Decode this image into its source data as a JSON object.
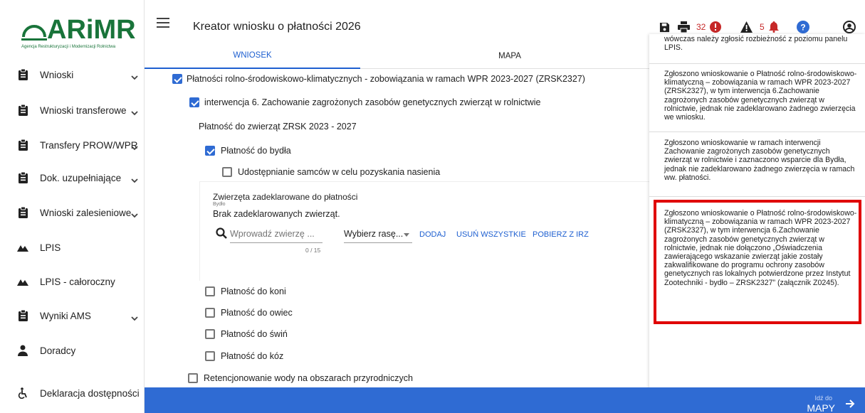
{
  "logo": {
    "text": "ARiMR",
    "subtitle": "Agencja Restrukturyzacji i Modernizacji Rolnictwa"
  },
  "sidebar": {
    "items": [
      {
        "label": "Wnioski",
        "icon": "clipboard-icon",
        "expandable": true
      },
      {
        "label": "Wnioski transferowe",
        "icon": "clipboard-icon",
        "expandable": true
      },
      {
        "label": "Transfery PROW/WPR",
        "icon": "clipboard-icon",
        "expandable": true
      },
      {
        "label": "Dok. uzupełniające",
        "icon": "clipboard-icon",
        "expandable": true
      },
      {
        "label": "Wnioski zalesieniowe",
        "icon": "clipboard-icon",
        "expandable": true
      },
      {
        "label": "LPIS",
        "icon": "terrain-icon",
        "expandable": false
      },
      {
        "label": "LPIS - całoroczny",
        "icon": "terrain-icon",
        "expandable": false
      },
      {
        "label": "Wyniki AMS",
        "icon": "clipboard-icon",
        "expandable": true
      },
      {
        "label": "Doradcy",
        "icon": "person-icon",
        "expandable": false
      },
      {
        "label": "Deklaracja dostępności",
        "icon": "accessibility-icon",
        "expandable": false
      }
    ]
  },
  "header": {
    "title": "Kreator wniosku o płatności 2026",
    "error_count": "32",
    "warning_count": "5"
  },
  "tabs": [
    {
      "label": "WNIOSEK",
      "active": true
    },
    {
      "label": "MAPA",
      "active": false
    }
  ],
  "form": {
    "main_item": "Płatności rolno-środowiskowo-klimatycznych - zobowiązania w ramach WPR 2023-2027 (ZRSK2327)",
    "intervention": "interwencja 6. Zachowanie zagrożonych zasobów genetycznych zwierząt w rolnictwie",
    "section_title": "Płatność do zwierząt ZRSK 2023 - 2027",
    "cattle": "Płatność do bydła",
    "semen": "Udostępnianie samców w celu pozyskania nasienia",
    "panel": {
      "title": "Zwierzęta zadeklarowane do płatności",
      "subtitle": "Bydło",
      "empty": "Brak zadeklarowanych zwierząt.",
      "search_placeholder": "Wprowadź zwierzę ...",
      "counter": "0 / 15",
      "breed_select": "Wybierz rasę...",
      "add": "DODAJ",
      "remove_all": "USUŃ WSZYSTKIE",
      "fetch": "POBIERZ Z IRZ"
    },
    "horses": "Płatność do koni",
    "sheep": "Płatność do owiec",
    "pigs": "Płatność do świń",
    "goats": "Płatność do kóz",
    "retention": "Retencjonowanie wody na obszarach przyrodniczych"
  },
  "messages": [
    {
      "text": "wówczas należy zgłosić rozbieżność z poziomu panelu LPIS."
    },
    {
      "text": "Zgłoszono wnioskowanie o Płatność rolno-środowiskowo-klimatyczną – zobowiązania w ramach WPR 2023-2027 (ZRSK2327), w tym interwencja 6.Zachowanie zagrożonych zasobów genetycznych zwierząt w rolnictwie, jednak nie zadeklarowano żadnego zwierzęcia we wniosku."
    },
    {
      "text": "Zgłoszono wnioskowanie w ramach interwencji Zachowanie zagrożonych zasobów genetycznych zwierząt w rolnictwie i zaznaczono wsparcie dla Bydła, jednak nie zadeklarowano żadnego zwierzęcia w ramach ww. płatności."
    },
    {
      "text": "Zgłoszono wnioskowanie o Płatność rolno-środowiskowo-klimatyczną – zobowiązania w ramach WPR 2023-2027 (ZRSK2327), w tym interwencja 6.Zachowanie zagrożonych zasobów genetycznych zwierząt w rolnictwie, jednak nie dołączono „Oświadczenia zawierającego wskazanie zwierząt jakie zostały zakwalifikowane do programu ochrony zasobów genetycznych ras lokalnych potwierdzone przez Instytut Zootechniki - bydło – ZRSK2327” (załącznik Z0245)."
    }
  ],
  "bottom": {
    "goto_small": "Idź do",
    "goto_big": "MAPY"
  },
  "colors": {
    "brand": "#19743a",
    "accent": "#2f6bd3",
    "error": "#c62828",
    "highlight": "#e00000"
  }
}
